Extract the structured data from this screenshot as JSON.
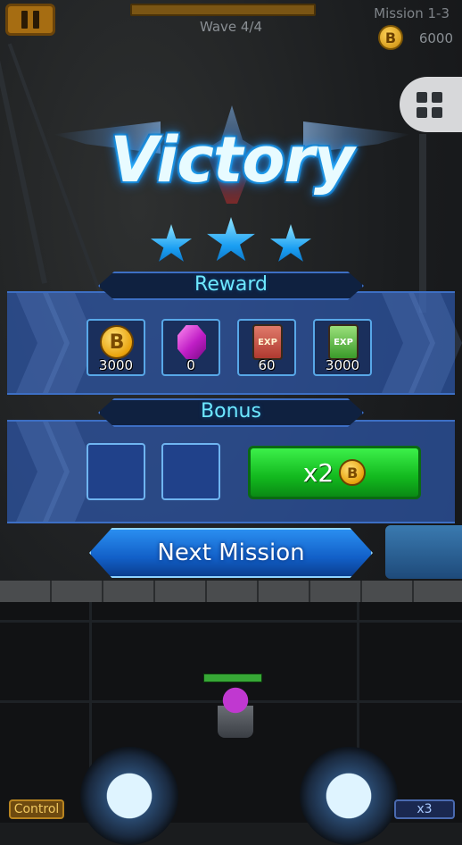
{
  "hud": {
    "wave": "Wave 4/4",
    "mission": "Mission 1-3",
    "coins": "6000",
    "coin_symbol": "B"
  },
  "result": {
    "title": "Victory",
    "stars_earned": 3,
    "stars_total": 3
  },
  "reward": {
    "title": "Reward",
    "items": [
      {
        "icon": "coin-icon",
        "value": "3000"
      },
      {
        "icon": "gem-icon",
        "value": "0"
      },
      {
        "icon": "exp-scroll-red-icon",
        "label": "EXP",
        "value": "60"
      },
      {
        "icon": "exp-scroll-green-icon",
        "label": "EXP",
        "value": "3000"
      }
    ]
  },
  "bonus": {
    "title": "Bonus",
    "multiplier_label": "x2",
    "coin_symbol": "B"
  },
  "next_mission_label": "Next Mission",
  "controls": {
    "control_label": "Control",
    "speed_label": "x3"
  },
  "colors": {
    "accent": "#6ee8ff",
    "bonus_button": "#12b81e",
    "next_button": "#1260c8"
  }
}
